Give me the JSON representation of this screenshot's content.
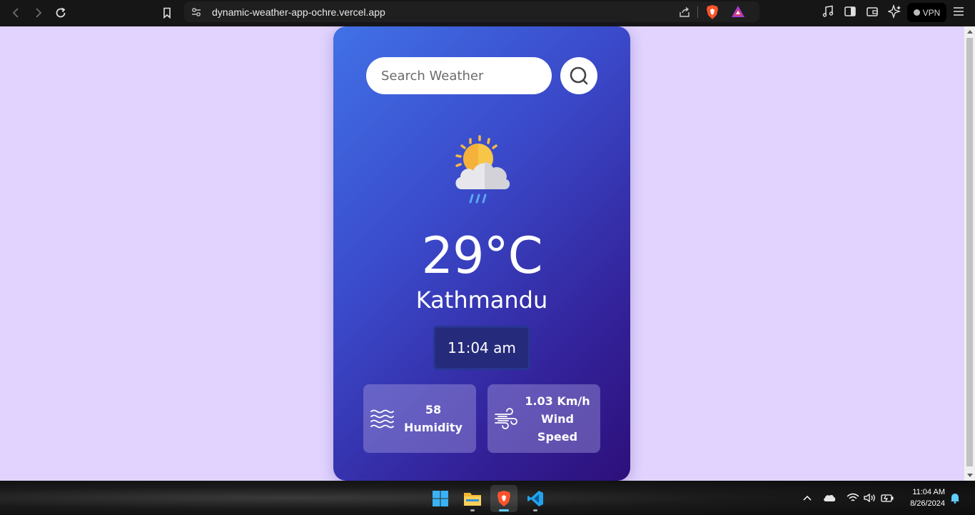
{
  "browser": {
    "url": "dynamic-weather-app-ochre.vercel.app",
    "vpn_label": "VPN"
  },
  "weather": {
    "search_placeholder": "Search Weather",
    "search_value": "",
    "temperature": "29°C",
    "city": "Kathmandu",
    "time": "11:04 am",
    "condition_icon": "sun-cloud-rain-icon",
    "humidity_value": "58",
    "humidity_label": "Humidity",
    "wind_value": "1.03 Km/h",
    "wind_label_line1": "Wind",
    "wind_label_line2": "Speed"
  },
  "colors": {
    "page_background": "#e1d3fe",
    "card_gradient_start": "#4171e6",
    "card_gradient_end": "#2d0f7a"
  },
  "taskbar": {
    "apps": [
      "windows-start-icon",
      "file-explorer-icon",
      "brave-browser-icon",
      "vscode-icon"
    ],
    "time": "11:04 AM",
    "date": "8/26/2024"
  }
}
